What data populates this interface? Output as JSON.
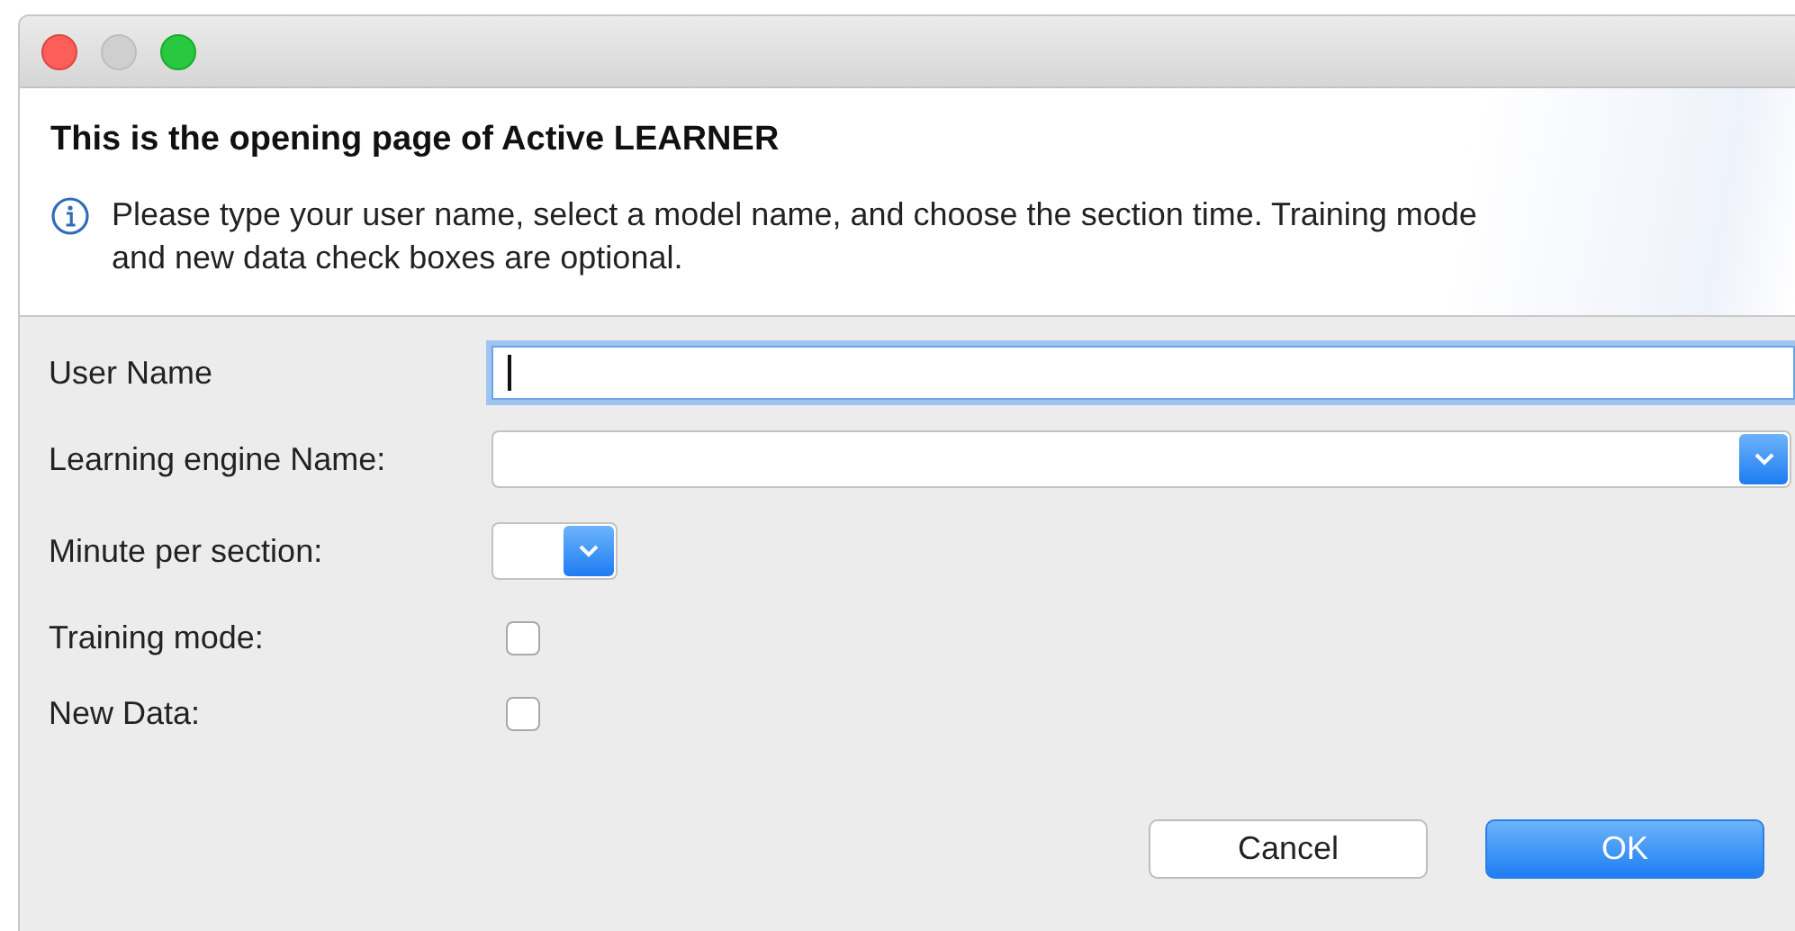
{
  "window": {
    "controls": [
      {
        "kind": "close",
        "disabled": false
      },
      {
        "kind": "minimize",
        "disabled": true
      },
      {
        "kind": "zoom",
        "disabled": false
      }
    ]
  },
  "header": {
    "title": "This is the opening page of Active LEARNER",
    "info": "Please type your user name, select a model name, and choose the section time. Training mode and new data check boxes are optional."
  },
  "fields": [
    {
      "kind": "text",
      "label": "User Name",
      "focused": true
    },
    {
      "kind": "combo",
      "label": "Learning engine Name:"
    },
    {
      "kind": "small-combo",
      "label": "Minute per section:"
    },
    {
      "kind": "checkbox",
      "label": "Training mode:",
      "checked": false
    },
    {
      "kind": "checkbox",
      "label": "New Data:",
      "checked": false
    }
  ],
  "buttons": [
    {
      "label": "Cancel",
      "default": false
    },
    {
      "label": "OK",
      "default": true
    }
  ]
}
